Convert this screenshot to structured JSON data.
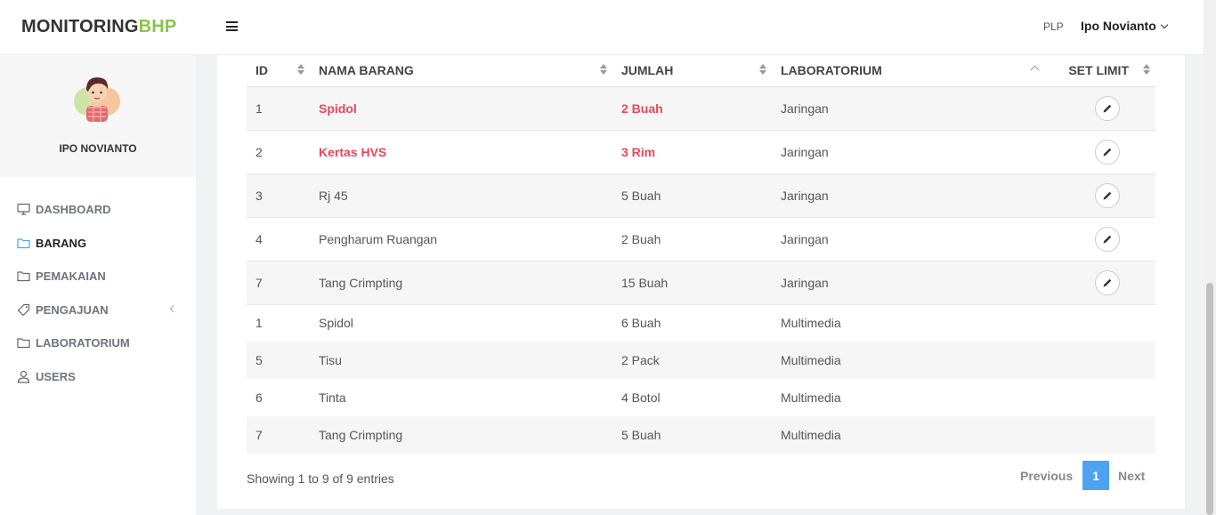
{
  "brand": {
    "part1": "MONITORING",
    "part2": "BHP",
    "accent": "#8bc34a"
  },
  "header": {
    "role": "PLP",
    "user_name": "Ipo Novianto"
  },
  "sidebar": {
    "profile_name": "IPO NOVIANTO",
    "items": [
      {
        "label": "DASHBOARD",
        "icon": "monitor-icon"
      },
      {
        "label": "BARANG",
        "icon": "folder-icon",
        "active": true
      },
      {
        "label": "PEMAKAIAN",
        "icon": "folder-icon"
      },
      {
        "label": "PENGAJUAN",
        "icon": "tag-icon"
      },
      {
        "label": "LABORATORIUM",
        "icon": "folder-icon"
      },
      {
        "label": "USERS",
        "icon": "user-icon"
      }
    ]
  },
  "table": {
    "headers": {
      "id": "ID",
      "nama": "NAMA BARANG",
      "jumlah": "JUMLAH",
      "lab": "LABORATORIUM",
      "set": "SET LIMIT"
    },
    "rows": [
      {
        "id": "1",
        "nama": "Spidol",
        "jumlah": "2 Buah",
        "lab": "Jaringan"
      },
      {
        "id": "2",
        "nama": "Kertas HVS",
        "jumlah": "3 Rim",
        "lab": "Jaringan"
      },
      {
        "id": "3",
        "nama": "Rj 45",
        "jumlah": "5 Buah",
        "lab": "Jaringan"
      },
      {
        "id": "4",
        "nama": "Pengharum Ruangan",
        "jumlah": "2 Buah",
        "lab": "Jaringan"
      },
      {
        "id": "7",
        "nama": "Tang Crimpting",
        "jumlah": "15 Buah",
        "lab": "Jaringan"
      },
      {
        "id": "1",
        "nama": "Spidol",
        "jumlah": "6 Buah",
        "lab": "Multimedia"
      },
      {
        "id": "5",
        "nama": "Tisu",
        "jumlah": "2 Pack",
        "lab": "Multimedia"
      },
      {
        "id": "6",
        "nama": "Tinta",
        "jumlah": "4 Botol",
        "lab": "Multimedia"
      },
      {
        "id": "7",
        "nama": "Tang Crimpting",
        "jumlah": "5 Buah",
        "lab": "Multimedia"
      }
    ]
  },
  "footer": {
    "info": "Showing 1 to 9 of 9 entries",
    "prev": "Previous",
    "page": "1",
    "next": "Next"
  },
  "colors": {
    "warning": "#e8475d",
    "page_active": "#4da3f2"
  }
}
